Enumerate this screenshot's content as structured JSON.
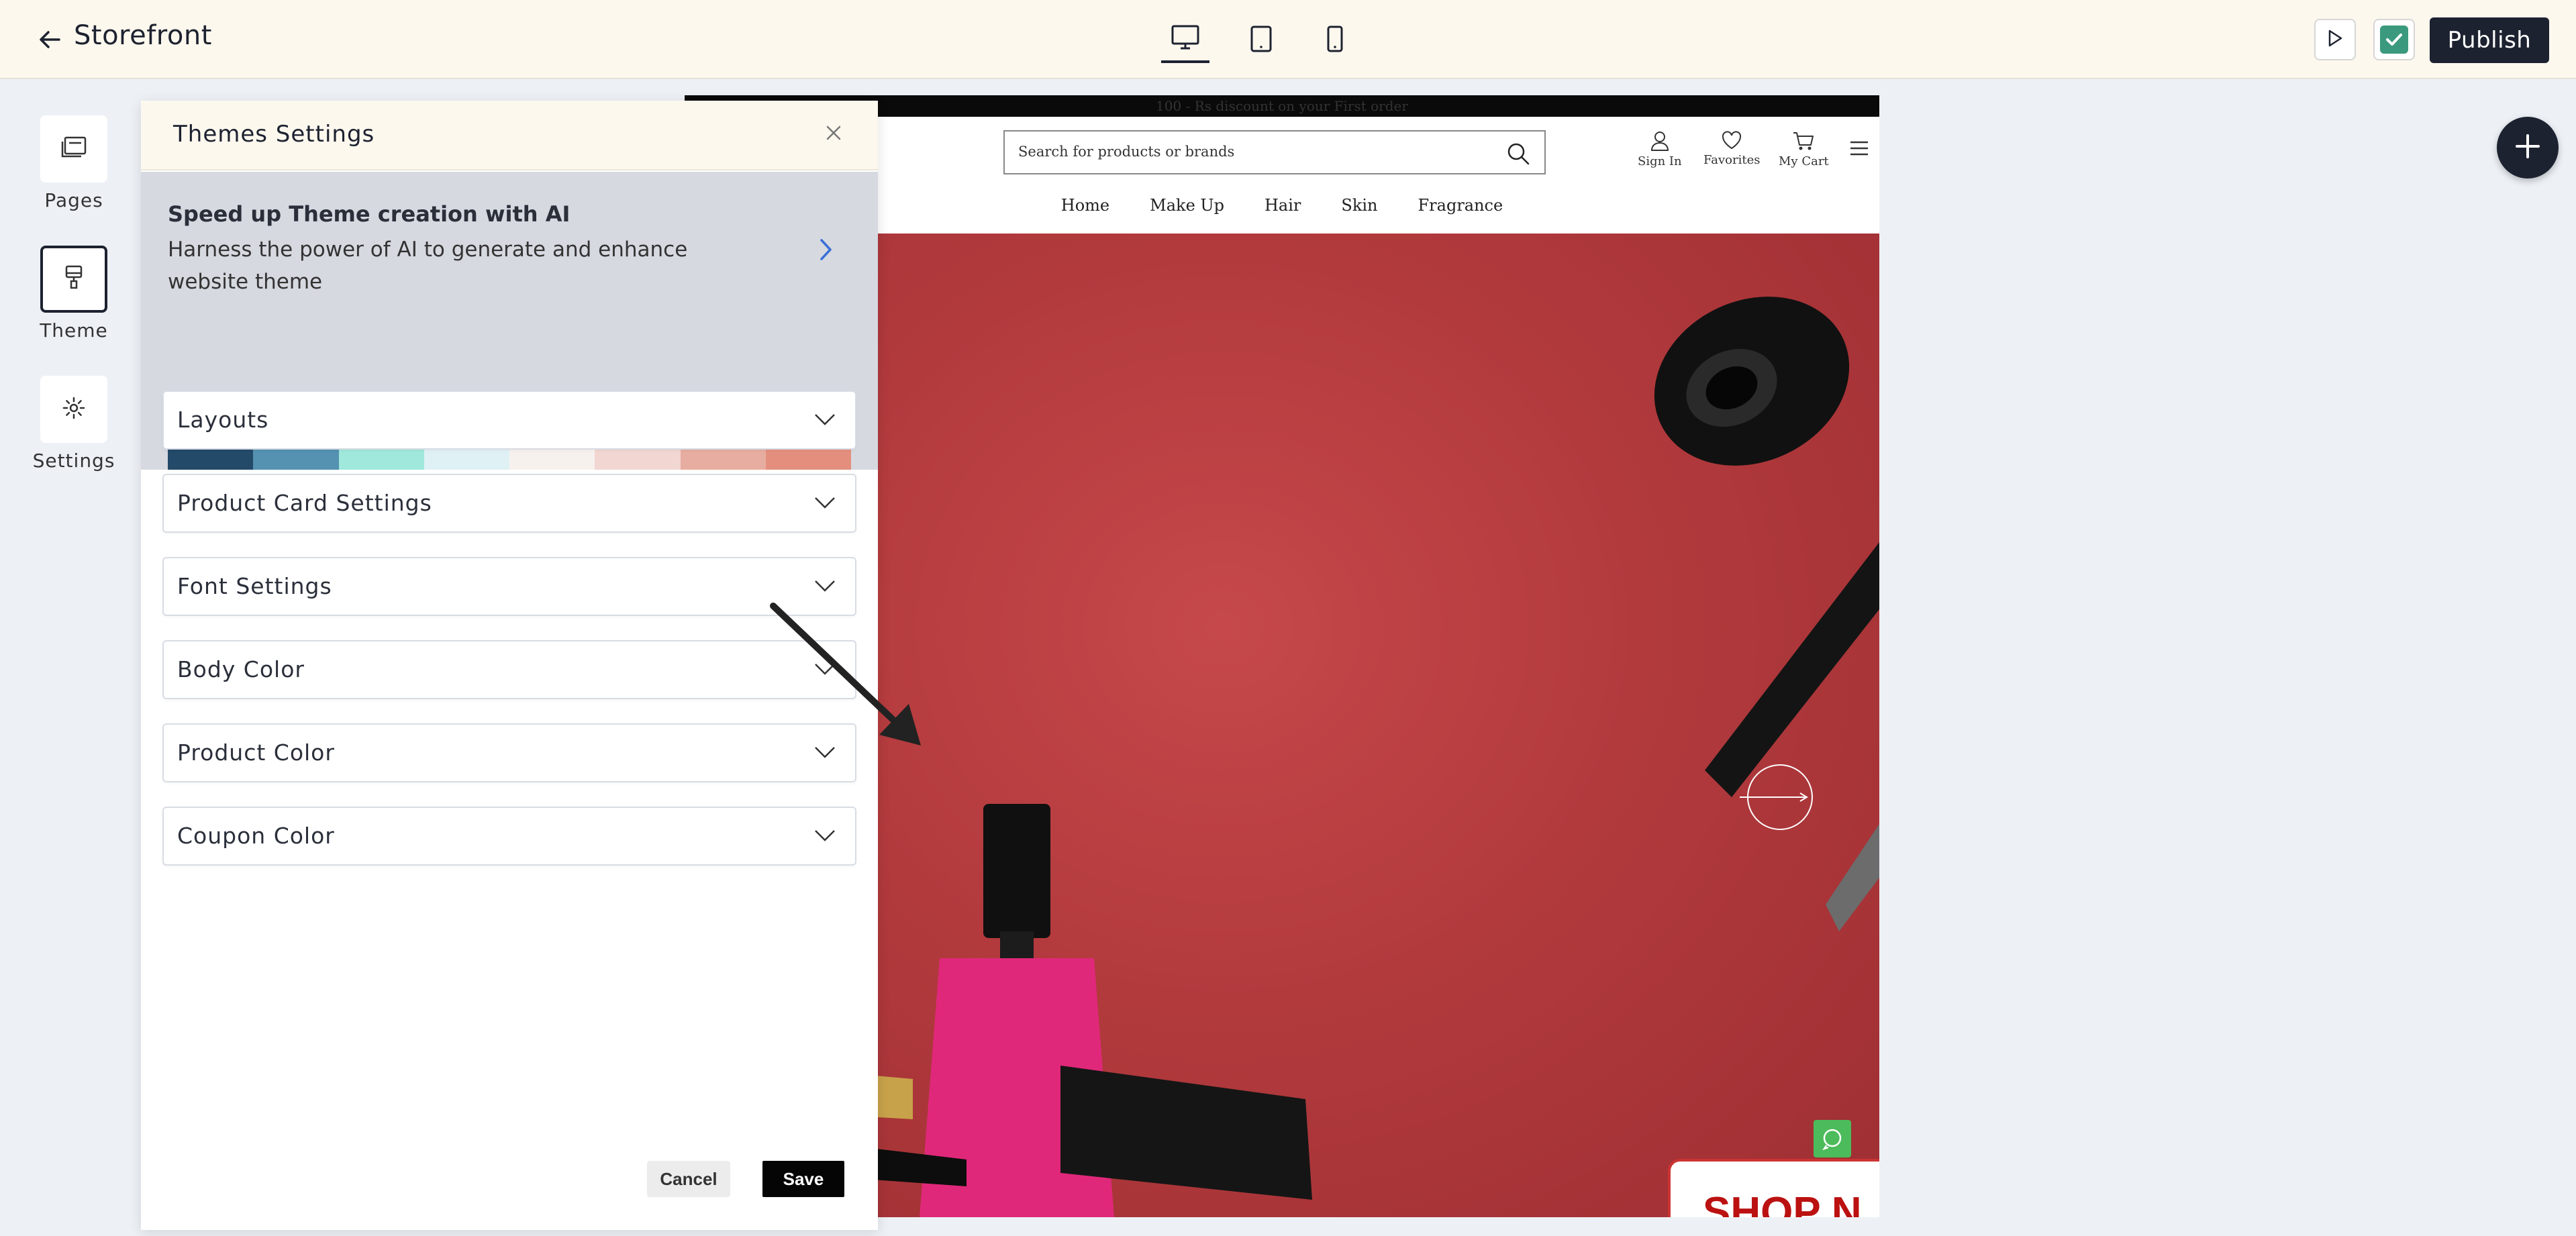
{
  "topbar": {
    "back_icon": "arrow-left-icon",
    "title": "Storefront",
    "devices": [
      {
        "name": "desktop",
        "icon": "desktop-icon",
        "active": true
      },
      {
        "name": "tablet",
        "icon": "tablet-icon",
        "active": false
      },
      {
        "name": "mobile",
        "icon": "mobile-icon",
        "active": false
      }
    ],
    "preview_icon": "play-icon",
    "save_status_icon": "checkbox-checked-icon",
    "publish_label": "Publish"
  },
  "sidebar": {
    "items": [
      {
        "label": "Pages",
        "icon": "pages-icon",
        "active": false
      },
      {
        "label": "Theme",
        "icon": "brush-icon",
        "active": true
      },
      {
        "label": "Settings",
        "icon": "gear-icon",
        "active": false
      }
    ]
  },
  "theme_panel": {
    "title": "Themes Settings",
    "close_icon": "close-icon",
    "ai_banner": {
      "title": "Speed up Theme creation with AI",
      "description": "Harness the power of AI to generate and enhance website theme",
      "chevron_icon": "chevron-right-icon"
    },
    "palette": [
      "#234a69",
      "#5591b1",
      "#a1e8dc",
      "#dff1f4",
      "#f7f1ee",
      "#f2d6d2",
      "#e8ada1",
      "#e48f7e"
    ],
    "sections": [
      {
        "label": "Layouts"
      },
      {
        "label": "Product Card Settings"
      },
      {
        "label": "Font Settings"
      },
      {
        "label": "Body Color"
      },
      {
        "label": "Product Color"
      },
      {
        "label": "Coupon Color"
      }
    ],
    "cancel_label": "Cancel",
    "save_label": "Save"
  },
  "preview": {
    "announcement": "100 - Rs discount on your First order",
    "search_placeholder": "Search for products or brands",
    "header_icons": [
      {
        "label": "Sign In",
        "icon": "user-icon"
      },
      {
        "label": "Favorites",
        "icon": "heart-icon"
      },
      {
        "label": "My Cart",
        "icon": "cart-icon"
      }
    ],
    "menu_icon": "hamburger-icon",
    "nav": [
      "Home",
      "Make Up",
      "Hair",
      "Skin",
      "Fragrance"
    ],
    "hero_cta": "SHOP N",
    "whatsapp_icon": "whatsapp-icon",
    "next_arrow_icon": "arrow-right-circle-icon"
  },
  "add_button_icon": "plus-icon"
}
